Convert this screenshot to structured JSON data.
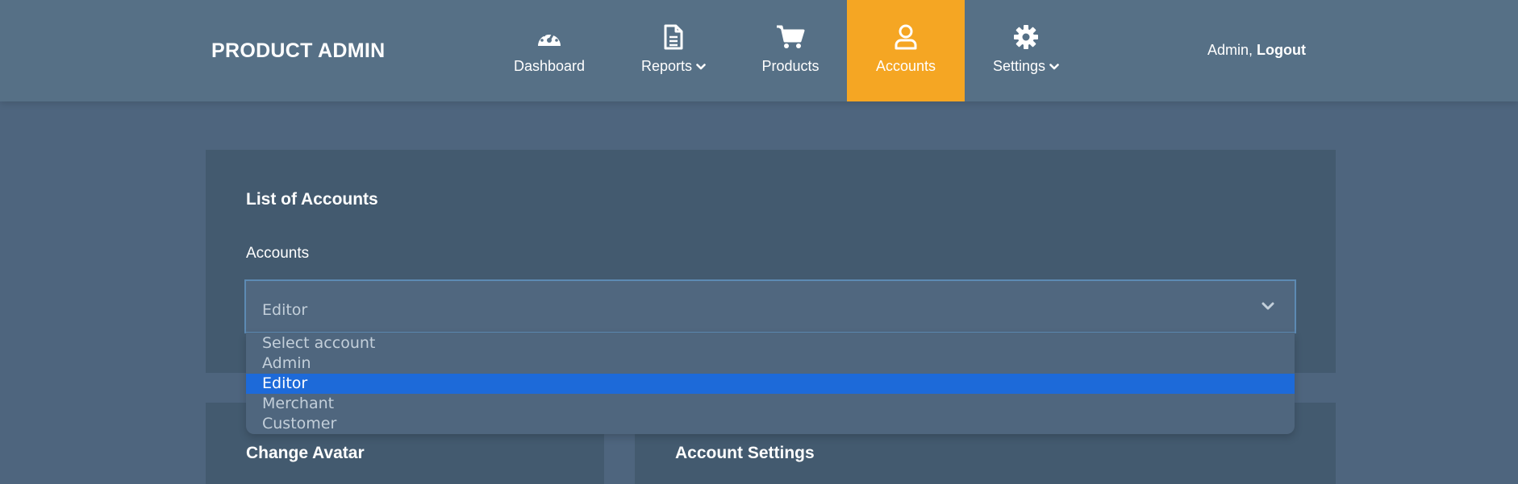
{
  "brand": "PRODUCT ADMIN",
  "nav": {
    "items": [
      {
        "label": "Dashboard",
        "icon": "dashboard-gauge-icon"
      },
      {
        "label": "Reports",
        "icon": "document-icon",
        "caret": true
      },
      {
        "label": "Products",
        "icon": "shopping-cart-icon"
      },
      {
        "label": "Accounts",
        "icon": "user-icon",
        "active": true
      },
      {
        "label": "Settings",
        "icon": "gear-icon",
        "caret": true
      }
    ],
    "active_color": "#f5a623"
  },
  "user": {
    "name": "Admin,",
    "logout_label": "Logout"
  },
  "accounts_panel": {
    "title": "List of Accounts",
    "field_label": "Accounts",
    "selected_value": "Editor",
    "options": [
      "Select account",
      "Admin",
      "Editor",
      "Merchant",
      "Customer"
    ],
    "highlighted_option": "Editor",
    "highlight_color": "#1d6ad9"
  },
  "cards": {
    "avatar_title": "Change Avatar",
    "settings_title": "Account Settings"
  }
}
